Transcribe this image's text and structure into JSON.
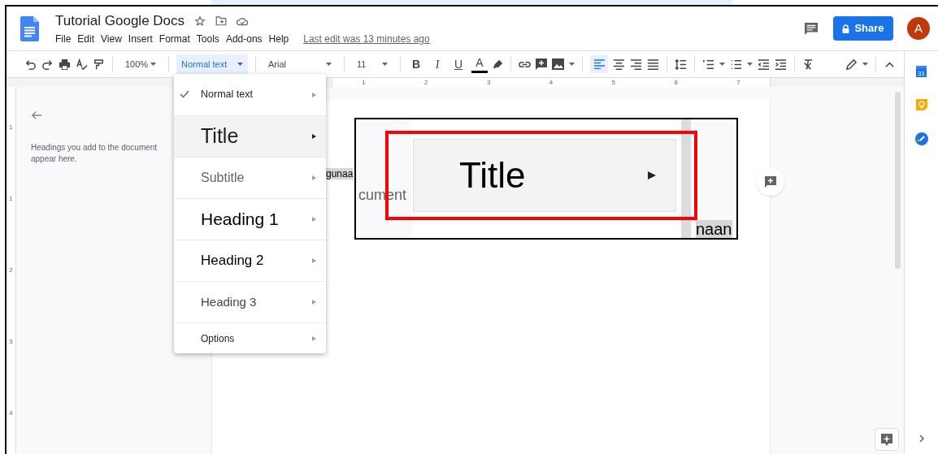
{
  "document": {
    "title": "Tutorial Google Docs"
  },
  "menu_bar": [
    "File",
    "Edit",
    "View",
    "Insert",
    "Format",
    "Tools",
    "Add-ons",
    "Help"
  ],
  "last_edit": "Last edit was 13 minutes ago",
  "share_button": "Share",
  "avatar": "A",
  "toolbar": {
    "zoom": "100%",
    "style": "Normal text",
    "font": "Arial",
    "font_size": "11",
    "text_buttons": [
      "B",
      "I",
      "U",
      "A"
    ]
  },
  "ruler": [
    "1",
    "2",
    "3",
    "4",
    "5",
    "6",
    "7"
  ],
  "vertical_ruler": [
    "1",
    "1",
    "2",
    "3",
    "4"
  ],
  "outline": {
    "lines": [
      "Headings you add to the document",
      "appear here."
    ]
  },
  "style_menu": [
    {
      "label": "Normal text",
      "kind": "normal",
      "checked": true,
      "selected": false
    },
    {
      "label": "Title",
      "kind": "title",
      "checked": false,
      "selected": true
    },
    {
      "label": "Subtitle",
      "kind": "subtitle",
      "checked": false,
      "selected": false
    },
    {
      "label": "Heading 1",
      "kind": "heading1",
      "checked": false,
      "selected": false
    },
    {
      "label": "Heading 2",
      "kind": "heading2",
      "checked": false,
      "selected": false
    },
    {
      "label": "Heading 3",
      "kind": "heading3",
      "checked": false,
      "selected": false
    },
    {
      "label": "Options",
      "kind": "options",
      "checked": false,
      "selected": false
    }
  ],
  "doc_text": "gunaa",
  "callout": {
    "title": "Title",
    "left_text": "cument",
    "bottom_text": "naan"
  },
  "calendar_day": "31"
}
